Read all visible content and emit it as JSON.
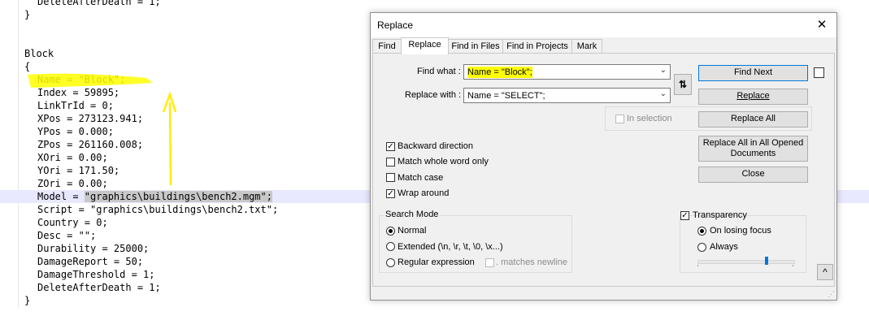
{
  "editor": {
    "lines": {
      "l0": "DeleteAfterDeath = 1;",
      "l0b": "}",
      "l1": "Block",
      "l2": "{",
      "l3": "Name = \"Block\";",
      "l4": "Index = 59895;",
      "l5": "LinkTrId = 0;",
      "l6": "XPos = 273123.941;",
      "l7": "YPos = 0.000;",
      "l8": "ZPos = 261160.008;",
      "l9": "XOri = 0.00;",
      "l10": "YOri = 171.50;",
      "l11": "ZOri = 0.00;",
      "l12a": "Model = ",
      "l12b": "\"graphics\\buildings\\bench2.mgm\";",
      "l13": "Script = \"graphics\\buildings\\bench2.txt\";",
      "l14": "Country = 0;",
      "l15": "Desc = \"\";",
      "l16": "Durability = 25000;",
      "l17": "DamageReport = 50;",
      "l18": "DamageThreshold = 1;",
      "l19": "DeleteAfterDeath = 1;",
      "l20": "}"
    },
    "annotation_color": "#ffff00"
  },
  "dialog": {
    "title": "Replace",
    "close_glyph": "✕",
    "tabs": [
      "Find",
      "Replace",
      "Find in Files",
      "Find in Projects",
      "Mark"
    ],
    "active_tab": "Replace",
    "find_label": "Find what :",
    "find_value": "Name = \"Block\";",
    "replace_label": "Replace with :",
    "replace_value": "Name = \"SELECT\";",
    "swap_glyph": "⇅",
    "in_selection": "In selection",
    "buttons": {
      "find_next": "Find Next",
      "replace": "Replace",
      "replace_all": "Replace All",
      "replace_all_opened": "Replace All in All Opened Documents",
      "close": "Close"
    },
    "options": {
      "backward": {
        "label": "Backward direction",
        "checked": true
      },
      "whole_word": {
        "label": "Match whole word only",
        "checked": false
      },
      "match_case": {
        "label": "Match case",
        "checked": false
      },
      "wrap_around": {
        "label": "Wrap around",
        "checked": true
      }
    },
    "search_mode": {
      "title": "Search Mode",
      "normal": "Normal",
      "extended": "Extended (\\n, \\r, \\t, \\0, \\x...)",
      "regex": "Regular expression",
      "matches_newline": ". matches newline",
      "selected": "Normal"
    },
    "transparency": {
      "title": "Transparency",
      "checked": true,
      "on_losing_focus": "On losing focus",
      "always": "Always",
      "selected": "On losing focus",
      "level": 0.7
    },
    "expand_glyph": "^",
    "check_glyph": "✓",
    "combo_arrow": "⌄"
  }
}
